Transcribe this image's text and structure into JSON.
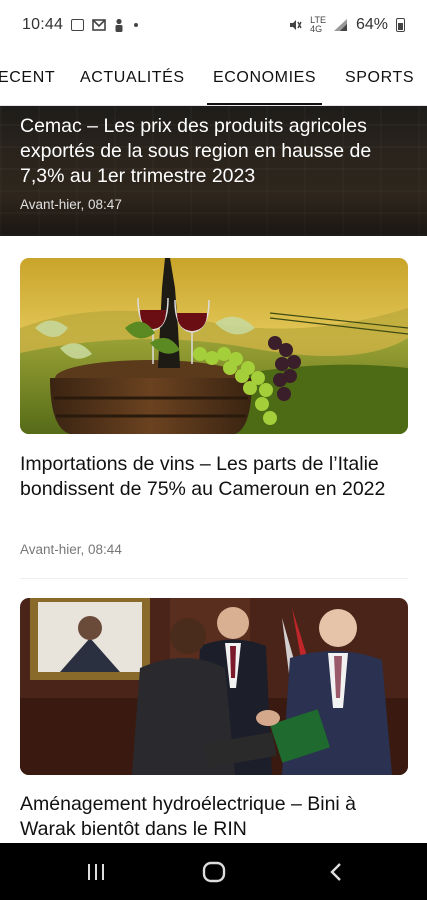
{
  "status_bar": {
    "time": "10:44",
    "network_label": "LTE",
    "network_sublabel": "4G",
    "battery_percent": "64%"
  },
  "tabs": [
    {
      "label": "RECENT",
      "display": "ECENT",
      "active": false
    },
    {
      "label": "ACTUALITÉS",
      "display": "ACTUALITÉS",
      "active": false
    },
    {
      "label": "ECONOMIES",
      "display": "ECONOMIES",
      "active": true
    },
    {
      "label": "SPORTS",
      "display": "SPORTS",
      "active": false
    }
  ],
  "hero": {
    "title": "Cemac – Les prix des produits agricoles exportés de la sous region  en hausse de 7,3% au 1er trimestre 2023",
    "time": "Avant-hier, 08:47"
  },
  "articles": [
    {
      "title": "Importations de vins – Les parts de l’Italie bondissent de 75% au Cameroun en 2022",
      "time": "Avant-hier, 08:44"
    },
    {
      "title": "Aménagement hydroélectrique – Bini à Warak bientôt dans le RIN",
      "time": ""
    }
  ],
  "colors": {
    "accent": "#111111",
    "nav_bar": "#000000",
    "meta_text": "#777777"
  },
  "icons": [
    "image-icon",
    "mail-icon",
    "person-icon",
    "mute-icon",
    "signal-icon",
    "battery-icon",
    "recents-icon",
    "home-icon",
    "back-icon"
  ]
}
